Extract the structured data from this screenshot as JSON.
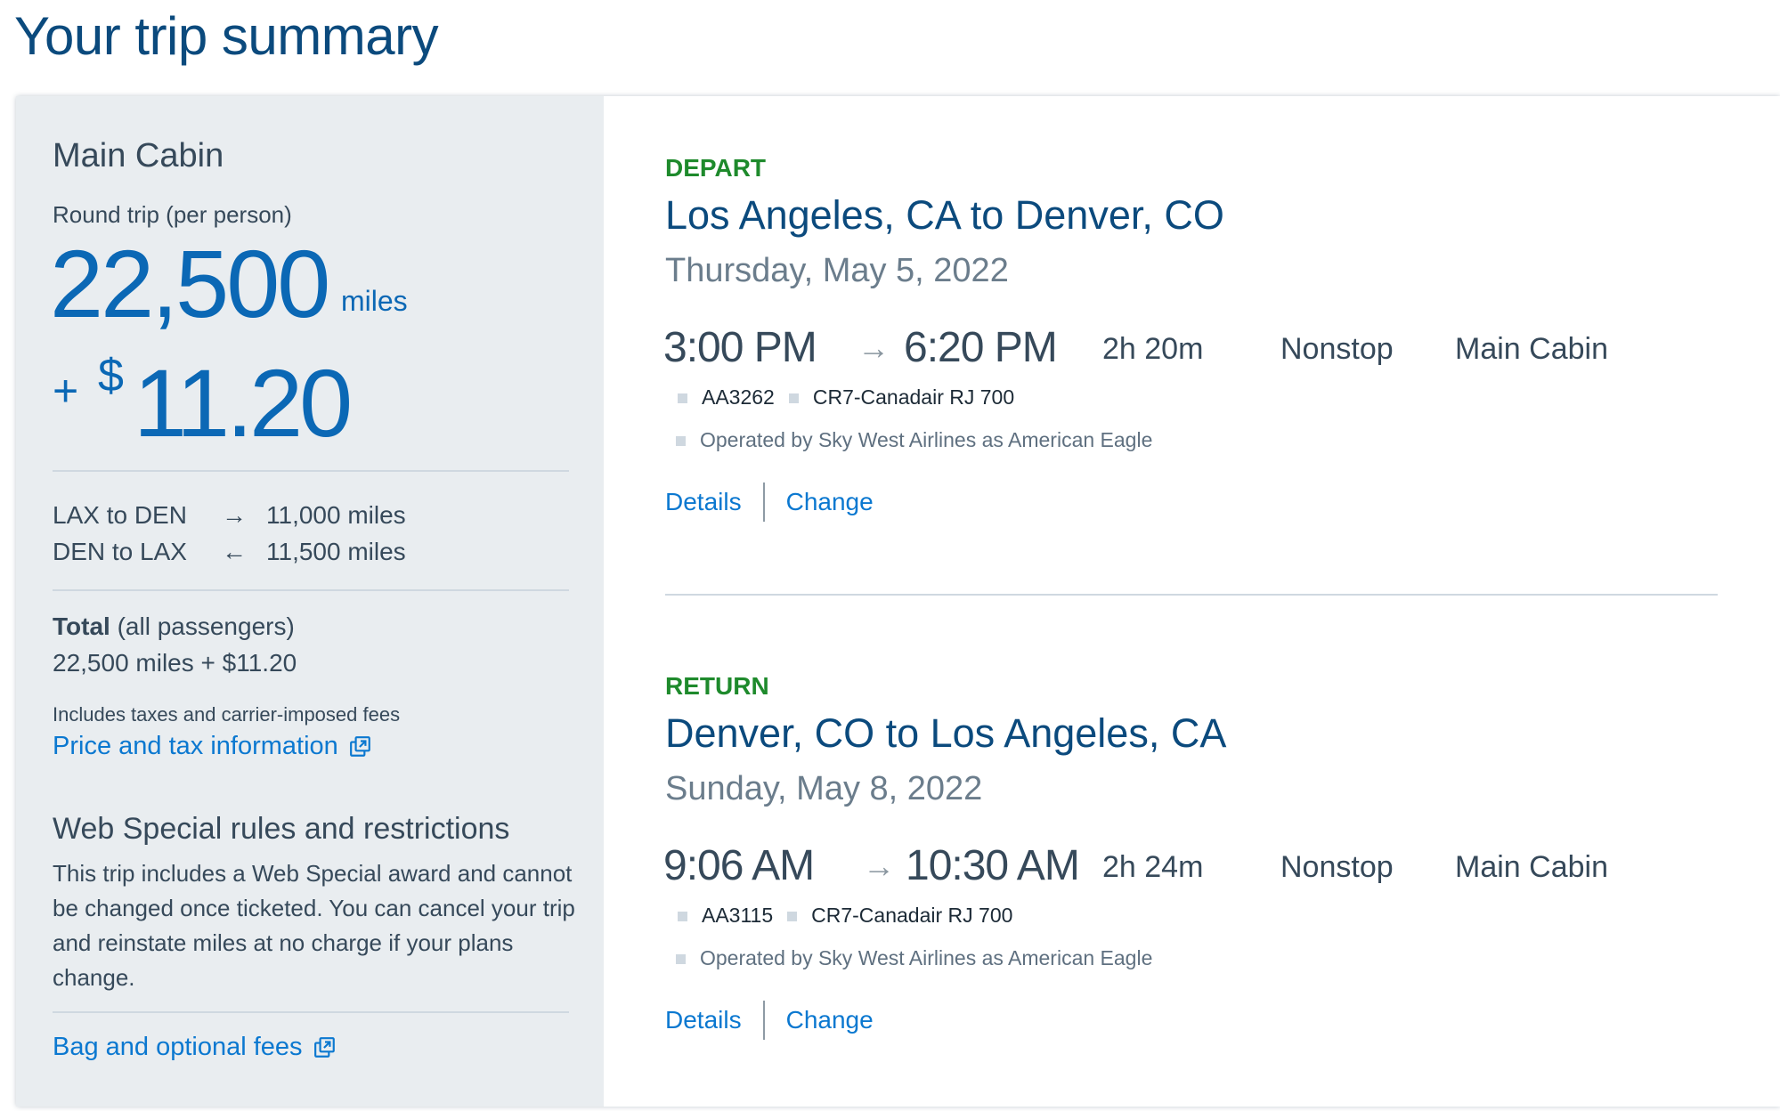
{
  "page": {
    "title": "Your trip summary"
  },
  "summary": {
    "cabin": "Main Cabin",
    "trip_type": "Round trip (per person)",
    "miles": "22,500",
    "miles_unit": "miles",
    "plus": "+",
    "currency_symbol": "$",
    "cash": "11.20",
    "segments": [
      {
        "route": "LAX to DEN",
        "direction_icon": "arrow-right-icon",
        "arrow": "→",
        "miles": "11,000 miles"
      },
      {
        "route": "DEN to LAX",
        "direction_icon": "arrow-left-icon",
        "arrow": "←",
        "miles": "11,500 miles"
      }
    ],
    "total_label": "Total",
    "total_qualifier": "(all passengers)",
    "total_value": "22,500 miles + $11.20",
    "includes_note": "Includes taxes and carrier-imposed fees",
    "price_tax_link": "Price and tax information",
    "web_special_heading": "Web Special rules and restrictions",
    "web_special_body": "This trip includes a Web Special award and cannot be changed once ticketed. You can cancel your trip and reinstate miles at no charge if your plans change.",
    "bag_fees_link": "Bag and optional fees"
  },
  "legs": [
    {
      "label": "DEPART",
      "route": "Los Angeles, CA to Denver, CO",
      "date": "Thursday, May 5, 2022",
      "depart_time": "3:00 PM",
      "arrow": "→",
      "arrive_time": "6:20 PM",
      "duration": "2h 20m",
      "stops": "Nonstop",
      "cabin": "Main Cabin",
      "flight_number": "AA3262",
      "aircraft": "CR7-Canadair RJ 700",
      "operated_by": "Operated by Sky West Airlines as American Eagle",
      "details_link": "Details",
      "change_link": "Change"
    },
    {
      "label": "RETURN",
      "route": "Denver, CO to Los Angeles, CA",
      "date": "Sunday, May 8, 2022",
      "depart_time": "9:06 AM",
      "arrow": "→",
      "arrive_time": "10:30 AM",
      "duration": "2h 24m",
      "stops": "Nonstop",
      "cabin": "Main Cabin",
      "flight_number": "AA3115",
      "aircraft": "CR7-Canadair RJ 700",
      "operated_by": "Operated by Sky West Airlines as American Eagle",
      "details_link": "Details",
      "change_link": "Change"
    }
  ],
  "colors": {
    "title_blue": "#0b4a7d",
    "price_blue": "#0b68b5",
    "link_blue": "#0b78d0",
    "leg_label_green": "#1e8a2c",
    "panel_gray": "#e9edf0"
  }
}
